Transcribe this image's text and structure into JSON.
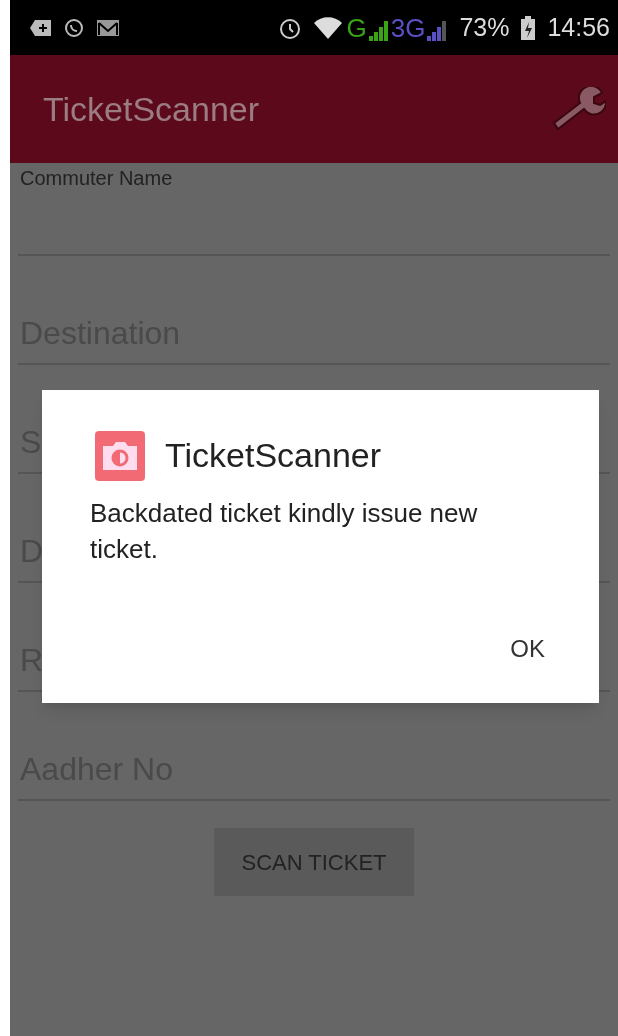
{
  "status_bar": {
    "network_labels": [
      "G",
      "3G"
    ],
    "battery": "73%",
    "time": "14:56"
  },
  "app_bar": {
    "title": "TicketScanner"
  },
  "form": {
    "fields": [
      {
        "kind": "labeled",
        "label": "Commuter Name"
      },
      {
        "kind": "placeholder",
        "placeholder": "Destination"
      },
      {
        "kind": "placeholder",
        "placeholder": "S"
      },
      {
        "kind": "placeholder",
        "placeholder": "D"
      },
      {
        "kind": "placeholder",
        "placeholder": "R"
      },
      {
        "kind": "placeholder",
        "placeholder": "Aadher No"
      }
    ],
    "button": "SCAN TICKET"
  },
  "dialog": {
    "title": "TicketScanner",
    "message": "Backdated ticket kindly issue new ticket.",
    "buttons": [
      "OK"
    ]
  }
}
